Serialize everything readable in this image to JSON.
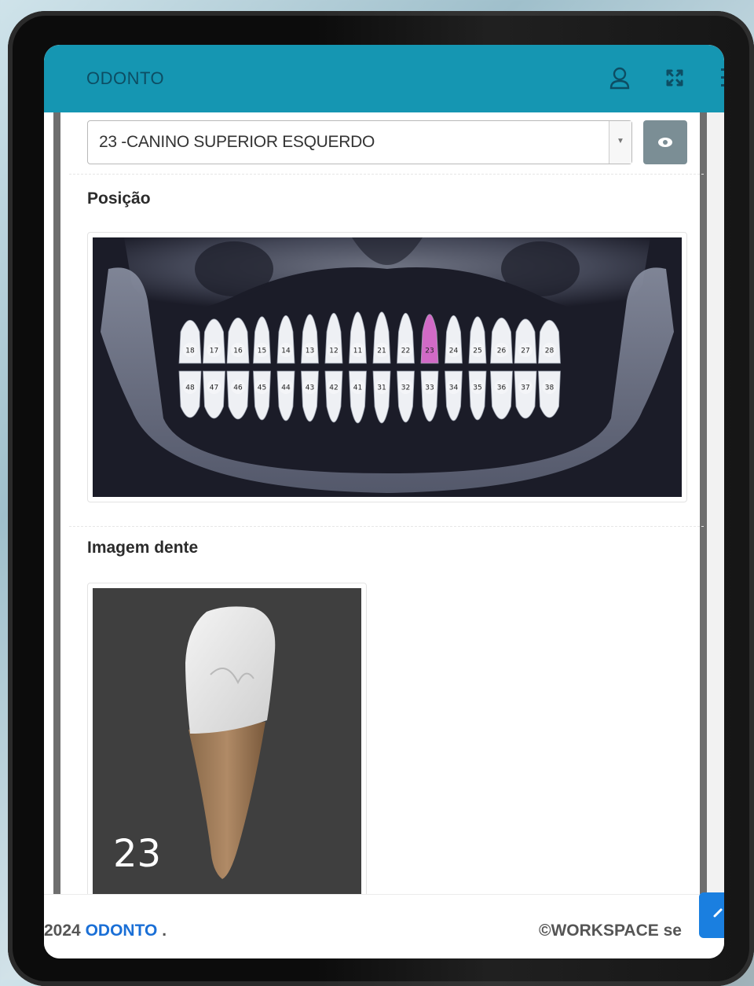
{
  "header": {
    "app_title": "ODONTO"
  },
  "form": {
    "tooth_select_value": "23 -CANINO SUPERIOR ESQUERDO",
    "position_label": "Posição",
    "tooth_image_label": "Imagem dente",
    "tooth_image_number": "23"
  },
  "dental_arch": {
    "upper_teeth": [
      "18",
      "17",
      "16",
      "15",
      "14",
      "13",
      "12",
      "11",
      "21",
      "22",
      "23",
      "24",
      "25",
      "26",
      "27",
      "28"
    ],
    "lower_teeth": [
      "48",
      "47",
      "46",
      "45",
      "44",
      "43",
      "42",
      "41",
      "31",
      "32",
      "33",
      "34",
      "35",
      "36",
      "37",
      "38"
    ],
    "highlighted_tooth": "23",
    "highlight_color": "#d16ac6"
  },
  "footer": {
    "year": "2024",
    "brand": "ODONTO",
    "brand_suffix": " .",
    "right_text": "©WORKSPACE se"
  },
  "colors": {
    "header_bg": "#1596b2",
    "view_button_bg": "#7b8e95",
    "footer_brand": "#1a6fd6",
    "scroll_top_button": "#1a7fe0"
  },
  "icons": {
    "user": "user-icon",
    "fullscreen": "fullscreen-icon",
    "view": "eye-icon",
    "scroll_top": "chevron-up-icon",
    "select": "caret-down-icon"
  }
}
